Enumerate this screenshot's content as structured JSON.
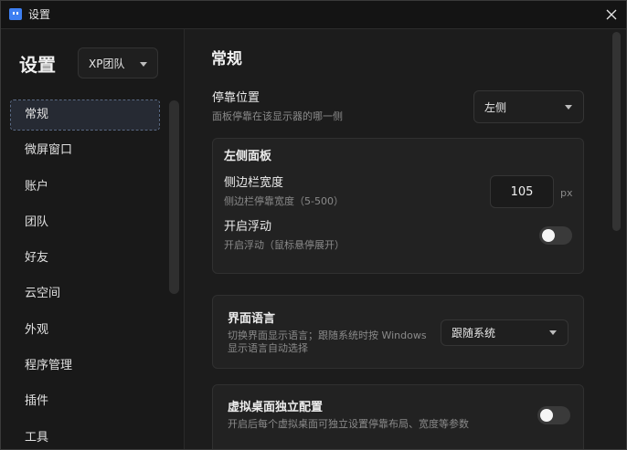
{
  "window": {
    "title": "设置",
    "app_icon": "app-logo-icon",
    "close_icon": "close-icon"
  },
  "sidebar": {
    "title": "设置",
    "team_select": {
      "value": "XP团队"
    },
    "items": [
      {
        "label": "常规",
        "active": true
      },
      {
        "label": "微屏窗口"
      },
      {
        "label": "账户"
      },
      {
        "label": "团队"
      },
      {
        "label": "好友"
      },
      {
        "label": "云空间"
      },
      {
        "label": "外观"
      },
      {
        "label": "程序管理"
      },
      {
        "label": "插件"
      },
      {
        "label": "工具"
      }
    ]
  },
  "main": {
    "title": "常规",
    "dock_position": {
      "label": "停靠位置",
      "desc": "面板停靠在该显示器的哪一侧",
      "value": "左侧"
    },
    "left_panel": {
      "title": "左侧面板",
      "sidebar_width": {
        "label": "侧边栏宽度",
        "desc": "侧边栏停靠宽度（5-500）",
        "value": "105",
        "unit": "px"
      },
      "float": {
        "label": "开启浮动",
        "desc": "开启浮动（鼠标悬停展开）",
        "on": false
      }
    },
    "language": {
      "label": "界面语言",
      "desc_line1": "切换界面显示语言；跟随系统时按 Windows",
      "desc_line2": "显示语言自动选择",
      "value": "跟随系统"
    },
    "virtual_desktop": {
      "label": "虚拟桌面独立配置",
      "desc": "开启后每个虚拟桌面可独立设置停靠布局、宽度等参数",
      "on": false
    }
  },
  "colors": {
    "accent": "#3d7ff2",
    "background": "#1c1c1c",
    "sidebar": "#191919",
    "panel": "#222222"
  }
}
